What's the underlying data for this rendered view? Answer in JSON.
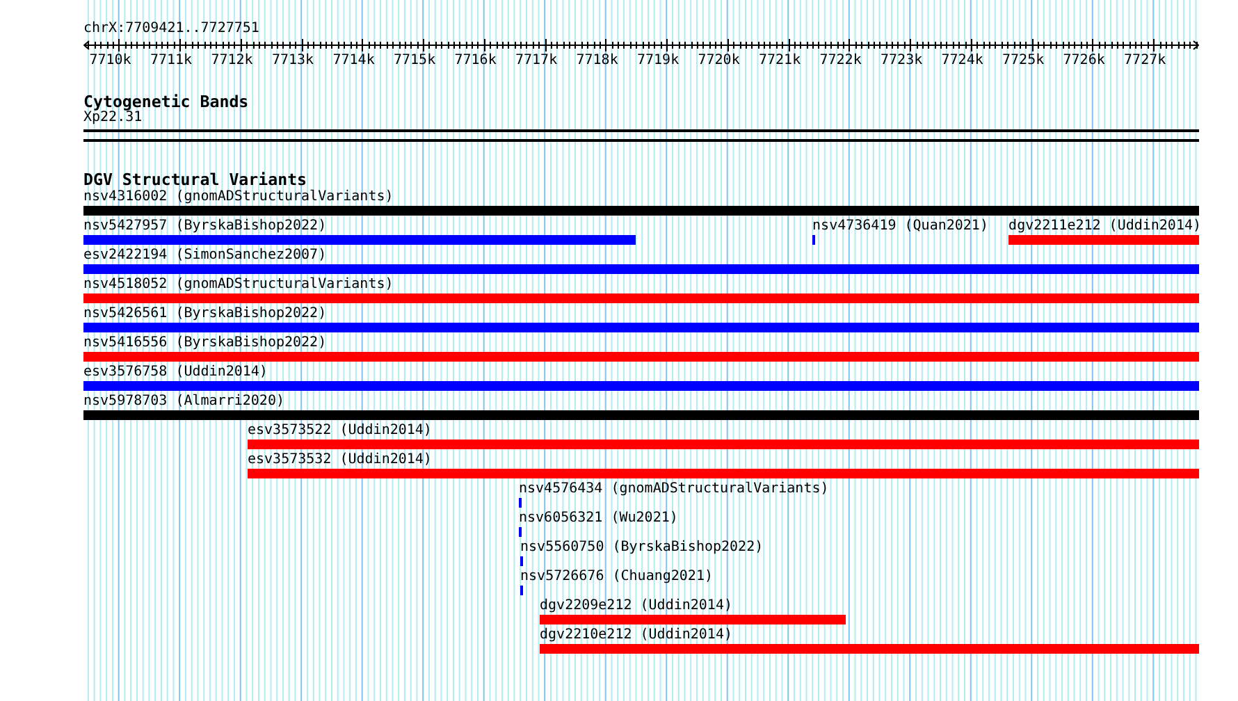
{
  "view": {
    "region": "chrX:7709421..7727751"
  },
  "ruler": {
    "tick_labels": [
      "7710k",
      "7711k",
      "7712k",
      "7713k",
      "7714k",
      "7715k",
      "7716k",
      "7717k",
      "7718k",
      "7719k",
      "7720k",
      "7721k",
      "7722k",
      "7723k",
      "7724k",
      "7725k",
      "7726k",
      "7727k"
    ]
  },
  "cytogenetic_bands": {
    "title": "Cytogenetic Bands",
    "band": "Xp22.31"
  },
  "dgv_structural_variants": {
    "title": "DGV Structural Variants",
    "rows": [
      {
        "features": [
          {
            "label": "nsv4316002 (gnomADStructuralVariants)",
            "color": "#000000"
          }
        ]
      },
      {
        "features": [
          {
            "label": "nsv5427957 (ByrskaBishop2022)",
            "color": "#0000ff"
          },
          {
            "label": "nsv4736419 (Quan2021)",
            "color": "#0000ff"
          },
          {
            "label": "dgv2211e212 (Uddin2014)",
            "color": "#ff0000"
          }
        ]
      },
      {
        "features": [
          {
            "label": "esv2422194 (SimonSanchez2007)",
            "color": "#0000ff"
          }
        ]
      },
      {
        "features": [
          {
            "label": "nsv4518052 (gnomADStructuralVariants)",
            "color": "#ff0000"
          }
        ]
      },
      {
        "features": [
          {
            "label": "nsv5426561 (ByrskaBishop2022)",
            "color": "#0000ff"
          }
        ]
      },
      {
        "features": [
          {
            "label": "nsv5416556 (ByrskaBishop2022)",
            "color": "#ff0000"
          }
        ]
      },
      {
        "features": [
          {
            "label": "esv3576758 (Uddin2014)",
            "color": "#0000ff"
          }
        ]
      },
      {
        "features": [
          {
            "label": "nsv5978703 (Almarri2020)",
            "color": "#000000"
          }
        ]
      },
      {
        "features": [
          {
            "label": "esv3573522 (Uddin2014)",
            "color": "#ff0000"
          }
        ]
      },
      {
        "features": [
          {
            "label": "esv3573532 (Uddin2014)",
            "color": "#ff0000"
          }
        ]
      },
      {
        "features": [
          {
            "label": "nsv4576434 (gnomADStructuralVariants)",
            "color": "#0000ff"
          }
        ]
      },
      {
        "features": [
          {
            "label": "nsv6056321 (Wu2021)",
            "color": "#0000ff"
          }
        ]
      },
      {
        "features": [
          {
            "label": "nsv5560750 (ByrskaBishop2022)",
            "color": "#0000ff"
          }
        ]
      },
      {
        "features": [
          {
            "label": "nsv5726676 (Chuang2021)",
            "color": "#0000ff"
          }
        ]
      },
      {
        "features": [
          {
            "label": "dgv2209e212 (Uddin2014)",
            "color": "#ff0000"
          }
        ]
      },
      {
        "features": [
          {
            "label": "dgv2210e212 (Uddin2014)",
            "color": "#ff0000"
          }
        ]
      }
    ]
  }
}
